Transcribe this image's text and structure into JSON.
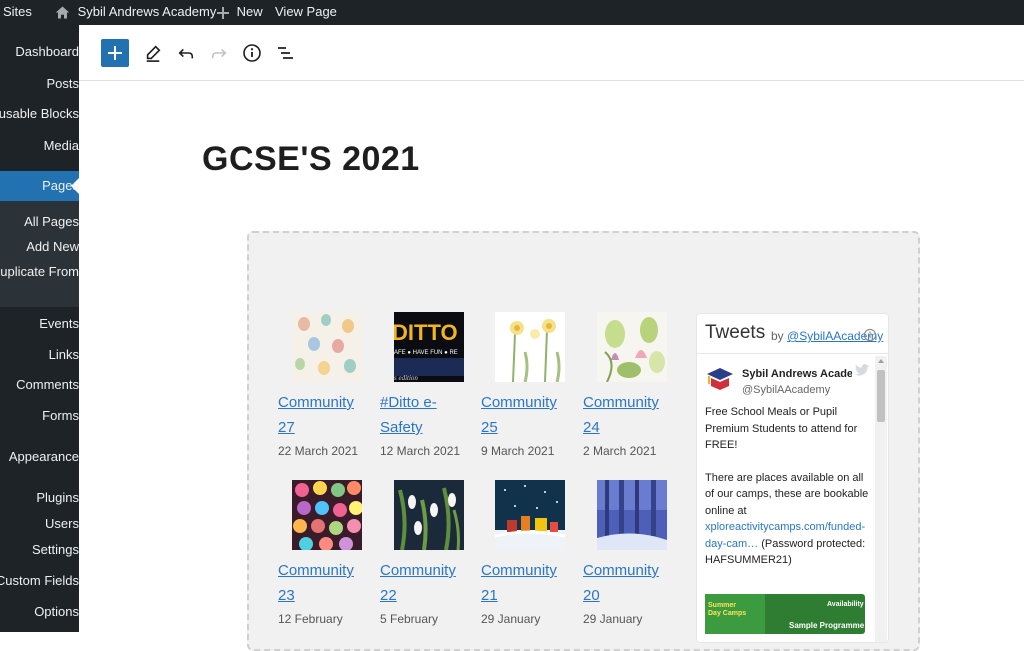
{
  "admin_bar": {
    "my_sites": "My Sites",
    "site_name": "Sybil Andrews Academy",
    "new_label": "New",
    "view_page": "View Page"
  },
  "sidebar": {
    "items": [
      {
        "label": "Dashboard"
      },
      {
        "label": "Posts"
      },
      {
        "label": "Reusable Blocks"
      },
      {
        "label": "Media"
      },
      {
        "label": "Pages"
      },
      {
        "label": "All Pages"
      },
      {
        "label": "Add New"
      },
      {
        "label": "Duplicate From"
      },
      {
        "label": "Events"
      },
      {
        "label": "Links"
      },
      {
        "label": "Comments"
      },
      {
        "label": "Forms"
      },
      {
        "label": "Appearance"
      },
      {
        "label": "Plugins"
      },
      {
        "label": "Users"
      },
      {
        "label": "Settings"
      },
      {
        "label": "Custom Fields"
      },
      {
        "label": "Options"
      }
    ]
  },
  "page": {
    "title": "GCSE'S 2021"
  },
  "posts": [
    {
      "title": "Community 27",
      "date": "22 March 2021",
      "thumb": "eggs"
    },
    {
      "title": "#Ditto e-Safety",
      "date": "12 March 2021",
      "thumb": "ditto"
    },
    {
      "title": "Community 25",
      "date": "9 March 2021",
      "thumb": "daffodils"
    },
    {
      "title": "Community 24",
      "date": "2 March 2021",
      "thumb": "tulips"
    },
    {
      "title": "Community 23",
      "date": "12 February",
      "thumb": "hearts"
    },
    {
      "title": "Community 22",
      "date": "5 February",
      "thumb": "snowdrops"
    },
    {
      "title": "Community 21",
      "date": "29 January",
      "thumb": "village"
    },
    {
      "title": "Community 20",
      "date": "29 January",
      "thumb": "forest"
    }
  ],
  "thumb_text": {
    "ditto_logo": "DITTO",
    "ditto_tagline": "AFE ● HAVE FUN ● RE",
    "ditto_edition": "s edition"
  },
  "twitter": {
    "title": "Tweets",
    "by": "by",
    "handle_link": "@SybilAAcademy",
    "account_name": "Sybil Andrews Academy",
    "account_handle": "@SybilAAcademy",
    "tweet_p1": "Free School Meals or Pupil Premium Students to attend for FREE!",
    "tweet_p2": "There are places available on all of our camps, these are bookable online at",
    "tweet_link": "xploreactivitycamps.com/funded-day-cam…",
    "tweet_p3": "(Password protected: HAFSUMMER21)",
    "img_text1": "Summer Day Camps",
    "img_text2": "Availability",
    "img_text3": "Sample Programme"
  },
  "colors": {
    "admin_bg": "#1d2327",
    "accent": "#2271b1",
    "link": "#2a76c6"
  }
}
